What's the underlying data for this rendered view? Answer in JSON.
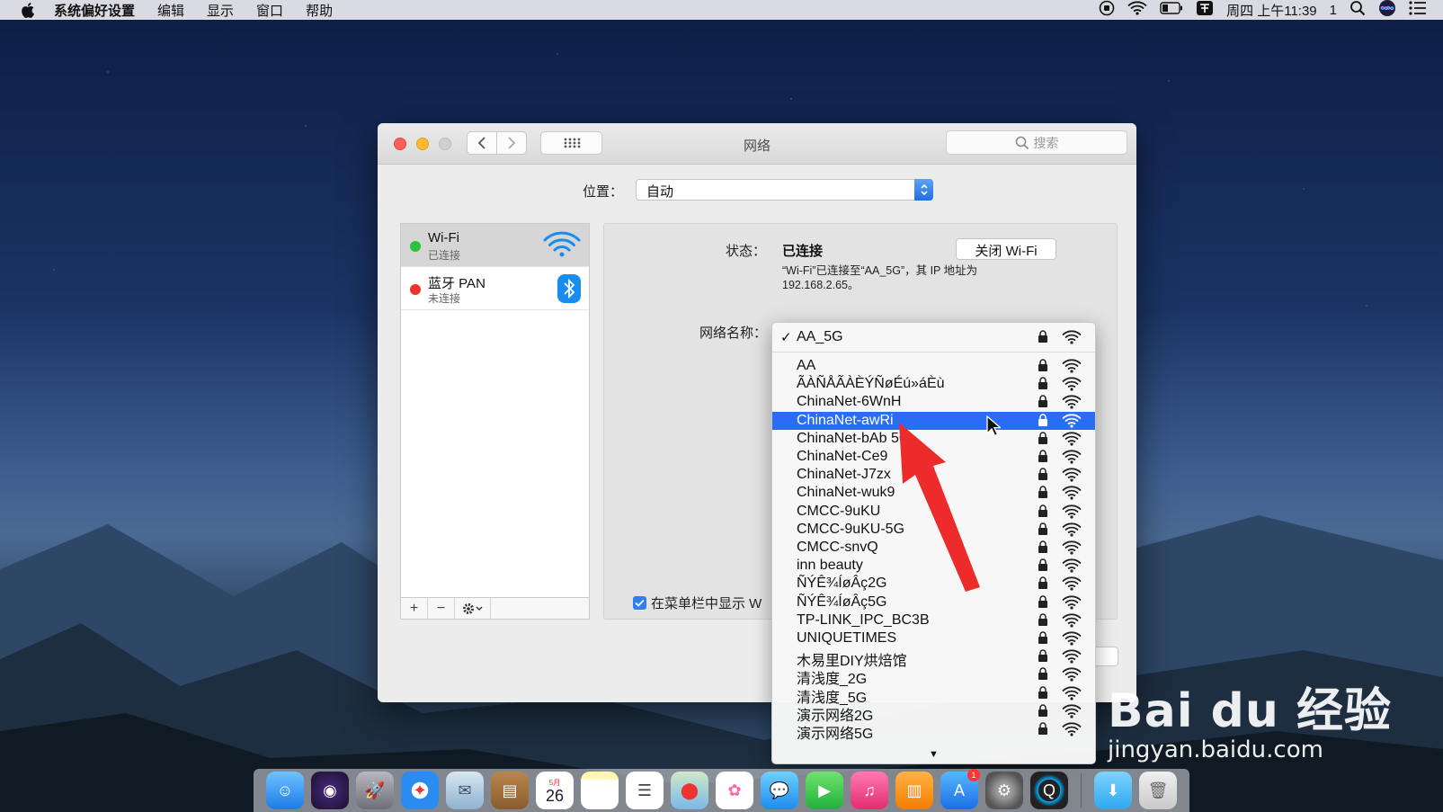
{
  "menubar": {
    "app_name": "系统偏好设置",
    "items": [
      "编辑",
      "显示",
      "窗口",
      "帮助"
    ],
    "clock": "周四 上午11:39",
    "user_number": "1"
  },
  "window": {
    "title": "网络",
    "search_placeholder": "搜索",
    "location_label": "位置：",
    "location_value": "自动"
  },
  "sidebar": {
    "services": [
      {
        "name": "Wi-Fi",
        "status": "已连接"
      },
      {
        "name": "蓝牙 PAN",
        "status": "未连接"
      }
    ],
    "tools": {
      "add": "+",
      "remove": "−"
    }
  },
  "detail": {
    "status_label": "状态：",
    "status_value": "已连接",
    "turn_off_label": "关闭 Wi-Fi",
    "status_desc": "“Wi-Fi”已连接至“AA_5G”，其 IP 地址为 192.168.2.65。",
    "network_name_label": "网络名称：",
    "show_in_menubar_label": "在菜单栏中显示 W"
  },
  "networks": {
    "current": "AA_5G",
    "list": [
      "AA",
      "ÃÀÑÅÃÀÈÝÑøÉú»áÈù",
      "ChinaNet-6WnH",
      "ChinaNet-awRi",
      "ChinaNet-bAb  5G",
      "ChinaNet-Ce9",
      "ChinaNet-J7zx",
      "ChinaNet-wuk9",
      "CMCC-9uKU",
      "CMCC-9uKU-5G",
      "CMCC-snvQ",
      "inn beauty",
      "ÑÝÊ¾ÍøÂç2G",
      "ÑÝÊ¾ÍøÂç5G",
      "TP-LINK_IPC_BC3B",
      "UNIQUETIMES",
      "木易里DIY烘焙馆",
      "清浅度_2G",
      "清浅度_5G",
      "演示网络2G",
      "演示网络5G"
    ],
    "highlighted": "ChinaNet-awRi"
  },
  "dock": {
    "calendar_month": "5月",
    "calendar_day": "26",
    "appstore_badge": "1"
  },
  "watermark": {
    "brand": "Bai du 经验",
    "url": "jingyan.baidu.com"
  },
  "colors": {
    "accent": "#2a6df4",
    "connected": "#28c33a",
    "disconnected": "#f0322d",
    "arrow": "#ee2b2b"
  }
}
